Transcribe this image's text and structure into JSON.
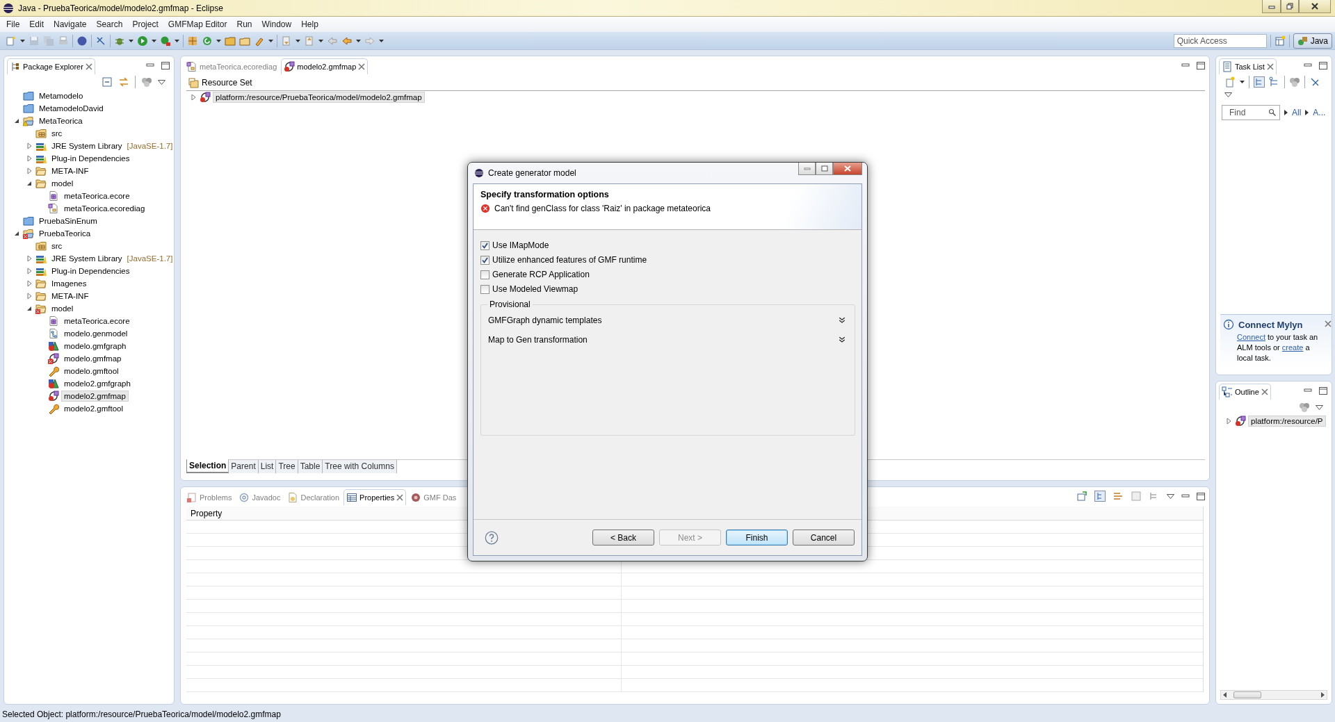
{
  "window": {
    "title": "Java - PruebaTeorica/model/modelo2.gmfmap - Eclipse"
  },
  "menu": [
    "File",
    "Edit",
    "Navigate",
    "Search",
    "Project",
    "GMFMap Editor",
    "Run",
    "Window",
    "Help"
  ],
  "toolbar": {
    "quick_access": {
      "placeholder": "Quick Access"
    },
    "perspective": {
      "label": "Java",
      "selected": true
    }
  },
  "package_explorer": {
    "title": "Package Explorer",
    "items": [
      {
        "label": "Metamodelo",
        "kind": "project",
        "error": false,
        "warning": false,
        "selected": false
      },
      {
        "label": "MetamodeloDavid",
        "kind": "project",
        "error": false,
        "warning": false,
        "selected": false
      },
      {
        "label": "MetaTeorica",
        "kind": "plugin-project",
        "error": false,
        "warning": true,
        "selected": false,
        "expanded": true,
        "children": [
          {
            "label": "src",
            "kind": "source-folder",
            "error": false,
            "warning": false,
            "selected": false
          },
          {
            "label": "JRE System Library",
            "suffix": "[JavaSE-1.7]",
            "kind": "library",
            "error": false,
            "warning": false,
            "selected": false,
            "expanded": false
          },
          {
            "label": "Plug-in Dependencies",
            "kind": "library",
            "error": false,
            "warning": false,
            "selected": false,
            "expanded": false
          },
          {
            "label": "META-INF",
            "kind": "folder",
            "error": false,
            "warning": false,
            "selected": false,
            "expanded": false
          },
          {
            "label": "model",
            "kind": "folder",
            "error": false,
            "warning": false,
            "selected": false,
            "expanded": true,
            "children": [
              {
                "label": "metaTeorica.ecore",
                "kind": "ecore",
                "error": false,
                "warning": false,
                "selected": false
              },
              {
                "label": "metaTeorica.ecorediag",
                "kind": "ecorediag",
                "error": false,
                "warning": false,
                "selected": false
              }
            ]
          }
        ]
      },
      {
        "label": "PruebaSinEnum",
        "kind": "project",
        "error": false,
        "warning": false,
        "selected": false
      },
      {
        "label": "PruebaTeorica",
        "kind": "plugin-project",
        "error": true,
        "warning": false,
        "selected": false,
        "expanded": true,
        "children": [
          {
            "label": "src",
            "kind": "source-folder",
            "error": false,
            "warning": false,
            "selected": false
          },
          {
            "label": "JRE System Library",
            "suffix": "[JavaSE-1.7]",
            "kind": "library",
            "error": false,
            "warning": false,
            "selected": false,
            "expanded": false
          },
          {
            "label": "Plug-in Dependencies",
            "kind": "library",
            "error": false,
            "warning": false,
            "selected": false,
            "expanded": false
          },
          {
            "label": "Imagenes",
            "kind": "folder",
            "error": false,
            "warning": false,
            "selected": false,
            "expanded": false
          },
          {
            "label": "META-INF",
            "kind": "folder",
            "error": false,
            "warning": false,
            "selected": false,
            "expanded": false
          },
          {
            "label": "model",
            "kind": "folder",
            "error": true,
            "warning": false,
            "selected": false,
            "expanded": true,
            "children": [
              {
                "label": "metaTeorica.ecore",
                "kind": "ecore",
                "error": false,
                "warning": false,
                "selected": false
              },
              {
                "label": "modelo.genmodel",
                "kind": "genmodel",
                "error": false,
                "warning": false,
                "selected": false
              },
              {
                "label": "modelo.gmfgraph",
                "kind": "gmfgraph",
                "error": false,
                "warning": false,
                "selected": false
              },
              {
                "label": "modelo.gmfmap",
                "kind": "gmfmap",
                "error": true,
                "warning": false,
                "selected": false
              },
              {
                "label": "modelo.gmftool",
                "kind": "gmftool",
                "error": false,
                "warning": false,
                "selected": false
              },
              {
                "label": "modelo2.gmfgraph",
                "kind": "gmfgraph",
                "error": false,
                "warning": false,
                "selected": false
              },
              {
                "label": "modelo2.gmfmap",
                "kind": "gmfmap",
                "error": false,
                "warning": false,
                "selected": true
              },
              {
                "label": "modelo2.gmftool",
                "kind": "gmftool",
                "error": false,
                "warning": false,
                "selected": false
              }
            ]
          }
        ]
      }
    ]
  },
  "editor": {
    "tabs": [
      {
        "label": "metaTeorica.ecorediag",
        "kind": "ecorediag",
        "selected": false
      },
      {
        "label": "modelo2.gmfmap",
        "kind": "gmfmap",
        "selected": true
      }
    ],
    "header": "Resource Set",
    "tree": [
      {
        "label": "platform:/resource/PruebaTeorica/model/modelo2.gmfmap",
        "kind": "gmfmap",
        "error": false,
        "warning": false,
        "selected": true,
        "expanded": false
      }
    ],
    "bottom_tabs": [
      {
        "label": "Selection",
        "selected": true
      },
      {
        "label": "Parent",
        "selected": false
      },
      {
        "label": "List",
        "selected": false
      },
      {
        "label": "Tree",
        "selected": false
      },
      {
        "label": "Table",
        "selected": false
      },
      {
        "label": "Tree with Columns",
        "selected": false
      }
    ]
  },
  "properties_view": {
    "tabs": [
      {
        "label": "Problems",
        "kind": "problems",
        "selected": false
      },
      {
        "label": "Javadoc",
        "kind": "javadoc",
        "selected": false
      },
      {
        "label": "Declaration",
        "kind": "declaration",
        "selected": false
      },
      {
        "label": "Properties",
        "kind": "properties",
        "selected": true
      },
      {
        "label": "GMF Das",
        "kind": "dashboard",
        "selected": false
      }
    ],
    "columns": [
      "Property"
    ]
  },
  "task_list": {
    "title": "Task List",
    "find": {
      "placeholder": "Find"
    },
    "filters": [
      "All",
      "A..."
    ],
    "mylyn": {
      "title": "Connect Mylyn",
      "lines": [
        [
          {
            "text": "Connect",
            "link": true
          },
          {
            "text": " to your task an",
            "link": false
          }
        ],
        [
          {
            "text": "ALM tools or ",
            "link": false
          },
          {
            "text": "create",
            "link": true
          },
          {
            "text": " a",
            "link": false
          }
        ],
        [
          {
            "text": "local task.",
            "link": false
          }
        ]
      ]
    }
  },
  "outline": {
    "title": "Outline",
    "tree": [
      {
        "label": "platform:/resource/P",
        "kind": "gmfmap",
        "error": false,
        "warning": false,
        "selected": true,
        "expanded": false
      }
    ]
  },
  "dialog": {
    "title": "Create generator model",
    "heading": "Specify transformation options",
    "message": "Can't find genClass for class 'Raiz' in package metateorica",
    "options": [
      {
        "label": "Use IMapMode",
        "checked": true
      },
      {
        "label": "Utilize enhanced features of GMF runtime",
        "checked": true
      },
      {
        "label": "Generate RCP Application",
        "checked": false
      },
      {
        "label": "Use Modeled Viewmap",
        "checked": false
      }
    ],
    "group": {
      "label": "Provisional",
      "sections": [
        {
          "label": "GMFGraph dynamic templates",
          "expanded": false
        },
        {
          "label": "Map to Gen transformation",
          "expanded": false
        }
      ]
    },
    "buttons": [
      {
        "label": "< Back",
        "disabled": false,
        "default": false
      },
      {
        "label": "Next >",
        "disabled": true,
        "default": false
      },
      {
        "label": "Finish",
        "disabled": false,
        "default": true
      },
      {
        "label": "Cancel",
        "disabled": false,
        "default": false
      }
    ]
  },
  "status_bar": "Selected Object: platform:/resource/PruebaTeorica/model/modelo2.gmfmap"
}
